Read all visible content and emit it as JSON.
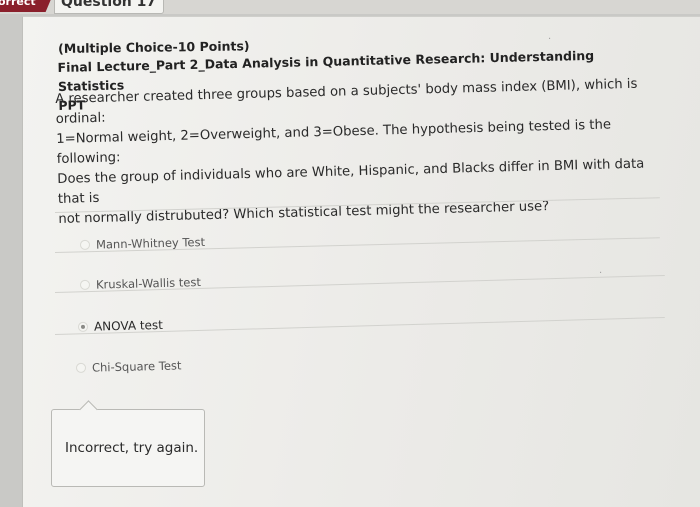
{
  "header": {
    "status_label": "orrect",
    "question_tab_label": "Question 17"
  },
  "question": {
    "meta": "(Multiple Choice-10 Points)",
    "course_title_line1": "Final Lecture_Part 2_Data Analysis in Quantitative Research: Understanding Statistics",
    "course_title_line2": "PPT",
    "text_lines": [
      "A researcher created three groups based on a subjects' body mass index (BMI), which is ordinal:",
      "1=Normal weight, 2=Overweight, and 3=Obese. The hypothesis being tested is the following:",
      "Does the group of individuals who are White, Hispanic, and Blacks differ in BMI with data that is",
      "not normally distrubuted? Which statistical test might the researcher use?"
    ]
  },
  "options": [
    {
      "label": "Mann-Whitney Test",
      "selected": false
    },
    {
      "label": "Kruskal-Wallis test",
      "selected": false
    },
    {
      "label": "ANOVA test",
      "selected": true
    },
    {
      "label": "Chi-Square Test",
      "selected": false
    }
  ],
  "feedback": {
    "text": "Incorrect, try again."
  }
}
